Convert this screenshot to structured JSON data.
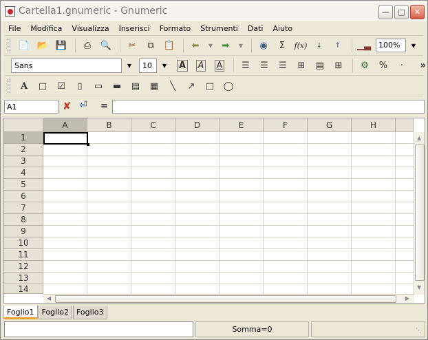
{
  "window": {
    "title": "Cartella1.gnumeric - Gnumeric",
    "minimize_icon": "minimize-icon",
    "maximize_icon": "maximize-icon",
    "close_icon": "close-icon"
  },
  "menubar": {
    "items": [
      "File",
      "Modifica",
      "Visualizza",
      "Inserisci",
      "Formato",
      "Strumenti",
      "Dati",
      "Aiuto"
    ]
  },
  "toolbar_standard": {
    "icons": [
      "new-file-icon",
      "open-file-icon",
      "save-icon",
      "print-icon",
      "print-preview-icon",
      "cut-icon",
      "copy-icon",
      "paste-icon",
      "undo-icon",
      "redo-icon",
      "hyperlink-icon",
      "sum-icon",
      "function-icon",
      "sort-ascending-icon",
      "sort-descending-icon",
      "chart-icon"
    ],
    "zoom_value": "100%"
  },
  "toolbar_format": {
    "font_name": "Sans",
    "font_size": "10",
    "bold_label": "A",
    "italic_label": "A",
    "underline_label": "A",
    "percent_label": "%",
    "more_label": "»"
  },
  "formula_bar": {
    "cell_ref": "A1",
    "equals_label": "=",
    "formula_value": ""
  },
  "grid": {
    "columns": [
      "A",
      "B",
      "C",
      "D",
      "E",
      "F",
      "G",
      "H"
    ],
    "rows": [
      "1",
      "2",
      "3",
      "4",
      "5",
      "6",
      "7",
      "8",
      "9",
      "10",
      "11",
      "12",
      "13",
      "14"
    ],
    "selected_cell": "A1"
  },
  "sheets": {
    "tabs": [
      "Foglio1",
      "Foglio2",
      "Foglio3"
    ],
    "active": "Foglio1"
  },
  "statusbar": {
    "sum_text": "Somma=0",
    "left_text": ""
  }
}
